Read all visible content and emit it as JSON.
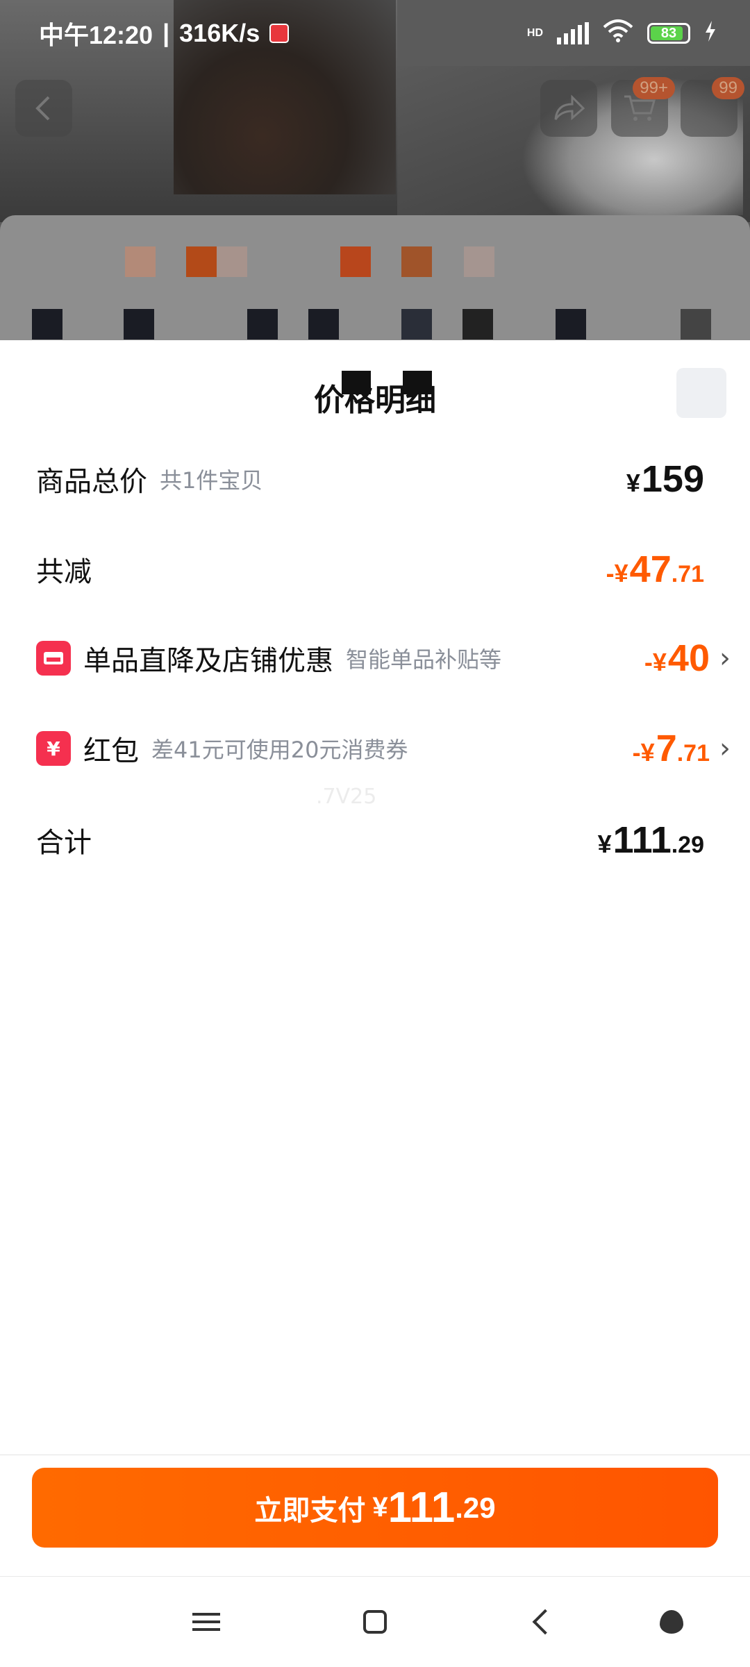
{
  "status_bar": {
    "time": "中午12:20",
    "separator": "|",
    "speed": "316K/s",
    "network": "HD",
    "battery": "83"
  },
  "header": {
    "cart_badge": "99+",
    "message_badge": "99"
  },
  "sheet": {
    "title": "价格明细",
    "rows": {
      "total": {
        "label": "商品总价",
        "sub": "共1件宝贝",
        "currency": "¥",
        "amount_main": "159",
        "amount_decimal": ""
      },
      "reduction": {
        "label": "共减",
        "currency": "-¥",
        "amount_main": "47",
        "amount_decimal": ".71"
      },
      "shop_discount": {
        "label": "单品直降及店铺优惠",
        "sub": "智能单品补贴等",
        "currency": "-¥",
        "amount_main": "40",
        "amount_decimal": ""
      },
      "red_packet": {
        "label": "红包",
        "sub": "差41元可使用20元消费券",
        "currency": "-¥",
        "amount_main": "7",
        "amount_decimal": ".71",
        "icon_glyph": "¥"
      },
      "sum": {
        "label": "合计",
        "currency": "¥",
        "amount_main": "111",
        "amount_decimal": ".29"
      }
    },
    "watermark": ".7V25"
  },
  "pay_button": {
    "label": "立即支付",
    "currency": "¥",
    "amount_main": "111",
    "amount_decimal": ".29"
  },
  "colors": {
    "accent": "#ff5a00",
    "icon_red": "#f5304f",
    "subtext": "#8a8f99"
  },
  "icons": [
    "back-icon",
    "share-icon",
    "cart-icon",
    "message-icon",
    "close-icon",
    "shop-icon",
    "red-packet-icon",
    "chevron-right-icon",
    "menu-icon",
    "home-icon",
    "nav-back-icon",
    "assistant-icon"
  ]
}
